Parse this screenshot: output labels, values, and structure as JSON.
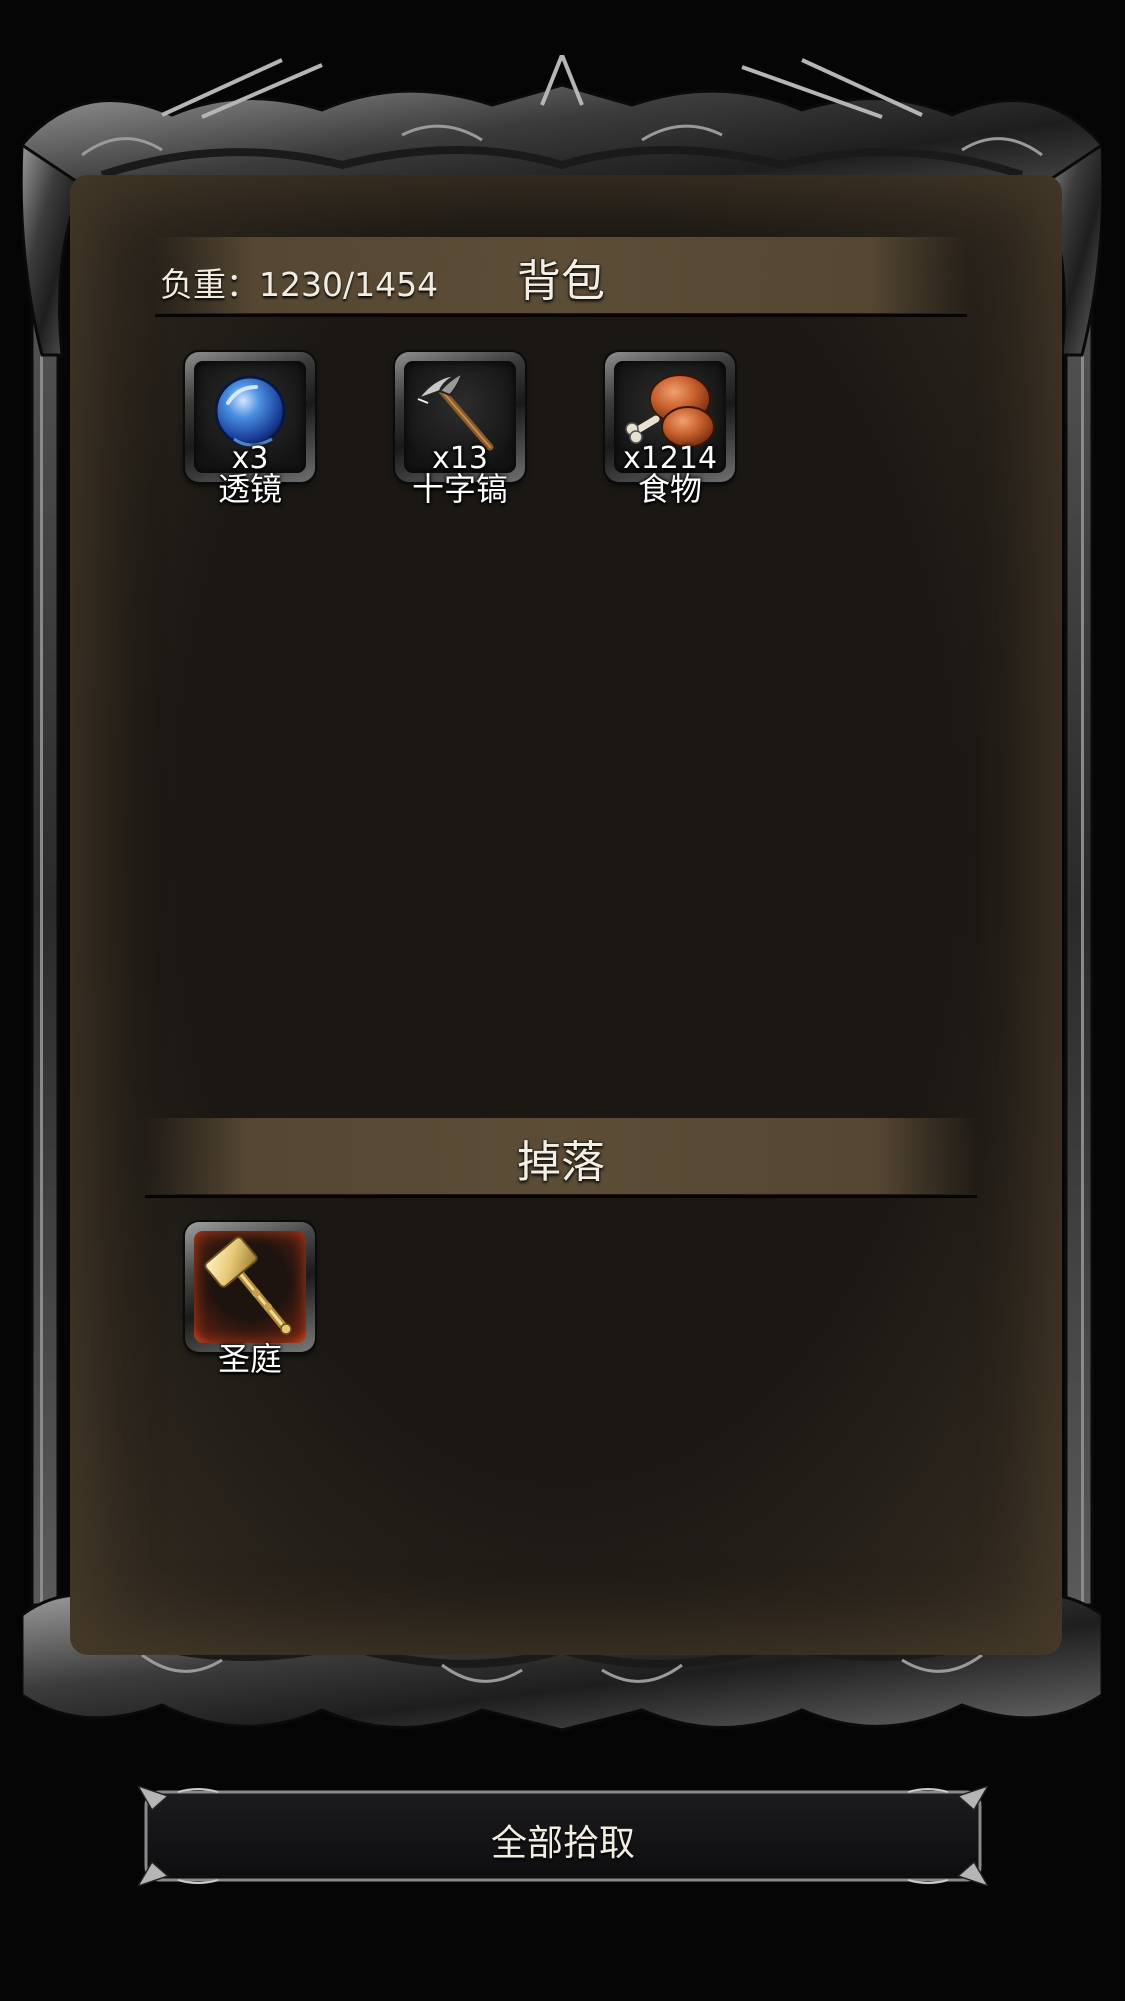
{
  "backpack": {
    "title": "背包",
    "weight_label": "负重：1230/1454",
    "items": [
      {
        "name": "透镜",
        "count": "x3",
        "icon": "lens-icon"
      },
      {
        "name": "十字镐",
        "count": "x13",
        "icon": "pickaxe-icon"
      },
      {
        "name": "食物",
        "count": "x1214",
        "icon": "food-drumstick-icon"
      }
    ]
  },
  "drops": {
    "title": "掉落",
    "items": [
      {
        "name": "圣庭",
        "icon": "hammer-icon"
      }
    ]
  },
  "pick_all_button": {
    "label": "全部拾取"
  },
  "colors": {
    "background": "#050505",
    "panel": "#1b1814",
    "header_band": "#5c4d37",
    "text": "#f2ede3",
    "rare_slot_glow": "#a8361b"
  }
}
